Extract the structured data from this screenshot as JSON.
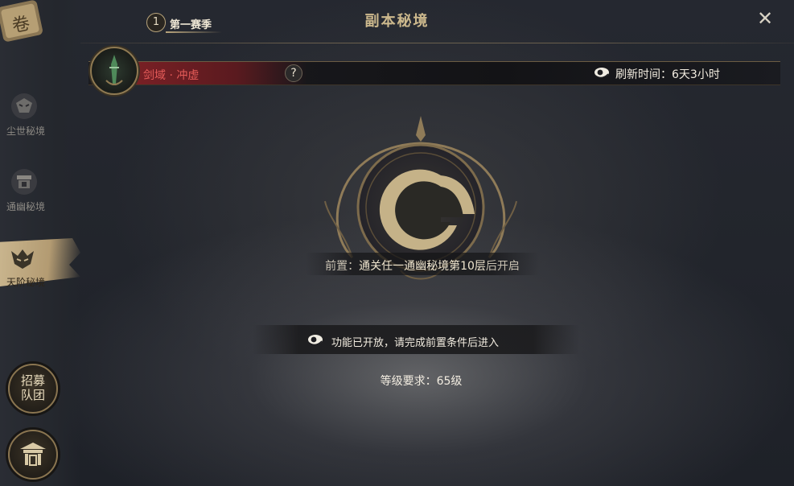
{
  "header": {
    "season_number": "1",
    "season_label": "第一赛季",
    "title": "副本秘境",
    "close_symbol": "✕"
  },
  "sidebar": {
    "items": [
      {
        "label": "尘世秘境",
        "icon": "mask-icon",
        "active": false
      },
      {
        "label": "通幽秘境",
        "icon": "shrine-icon",
        "active": false
      },
      {
        "label": "天阶秘境",
        "icon": "demon-mask-icon",
        "active": true
      }
    ],
    "team_recruit_label": "招募队团",
    "gate_icon": "gate-icon"
  },
  "dungeon": {
    "name": "剑域 · 冲虚",
    "help_symbol": "?",
    "refresh_label": "刷新时间：6天3小时"
  },
  "main": {
    "prereq_prefix": "前置：",
    "prereq_highlight": "通关任一通幽秘境第10层",
    "prereq_suffix": "后开启",
    "notice": "功能已开放，请完成前置条件后进入",
    "level_requirement": "等级要求：65级"
  },
  "colors": {
    "accent_gold": "#cdb98d",
    "dungeon_red": "#e45b58",
    "active_tab": "#c9b58e"
  }
}
